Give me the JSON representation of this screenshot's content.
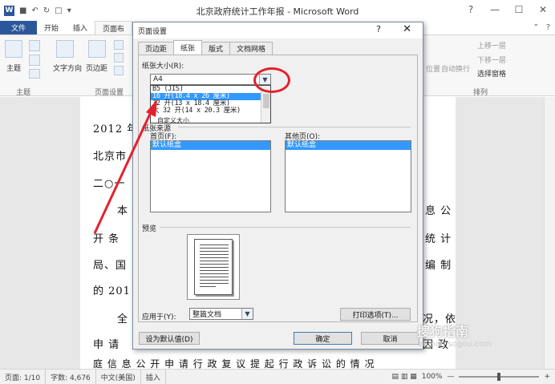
{
  "window": {
    "title": "北京政府统计工作年报 - Microsoft Word",
    "app_letter": "W",
    "controls": [
      "?",
      "—",
      "☐",
      "✕"
    ]
  },
  "tabs": [
    "文件",
    "开始",
    "插入",
    "页面布"
  ],
  "ribbon": {
    "theme_label": "主题",
    "theme_group": "主题",
    "orientation_label": "文字方向",
    "margins_label": "页边距",
    "page_setup_group": "页面设置",
    "bring_forward": "上移一层",
    "send_backward": "下移一层",
    "selection_pane": "选择窗格",
    "wrap_text": "自动换行",
    "position": "位置",
    "arrange_group": "排列"
  },
  "document": {
    "lines": [
      "2012 年",
      "北京市",
      "二○一",
      "本",
      "开 条",
      "局、国",
      "的 201",
      "全",
      "申 请",
      "庭 信 息 公 开 申 请 行 政 复 议  提 起 行 政 诉 讼 的 情 况"
    ],
    "right_fragments": [
      "息 公",
      "统 计",
      "编 制",
      "况，依",
      "因 政"
    ]
  },
  "dialog": {
    "title": "页面设置",
    "help": "?",
    "close": "✕",
    "tabs": [
      "页边距",
      "纸张",
      "版式",
      "文档网格"
    ],
    "active_tab": "纸张",
    "paper_size_label": "纸张大小(R):",
    "paper_size_value": "A4",
    "paper_size_options": [
      "B5 (JIS)",
      "16 开(18.4 x 26 厘米)",
      "32 开(13 x 18.4 厘米)",
      "大 32 开(14 x 20.3 厘米)"
    ],
    "selected_option_index": 1,
    "paper_source_label": "纸张来源",
    "custom_size_fragment": "自定义大小",
    "first_page_label": "首页(F):",
    "first_page_item": "默认纸盒",
    "other_pages_label": "其他页(O):",
    "other_pages_item": "默认纸盒",
    "preview_label": "预览",
    "apply_to_label": "应用于(Y):",
    "apply_to_value": "整篇文档",
    "print_options_button": "打印选项(T)...",
    "set_default_button": "设为默认值(D)",
    "ok_button": "确定",
    "cancel_button": "取消"
  },
  "status_bar": {
    "page": "页面: 1/10",
    "words": "字数: 4,676",
    "language": "中文(美国)",
    "mode": "插入",
    "zoom": "100%",
    "minus": "—",
    "plus": "+"
  },
  "watermark": {
    "brand": "搜狗指南",
    "url": "zhinan.sogou.com"
  },
  "colors": {
    "file_tab": "#2b579a",
    "selection": "#3399ff",
    "annotation_red": "#e5212d"
  }
}
